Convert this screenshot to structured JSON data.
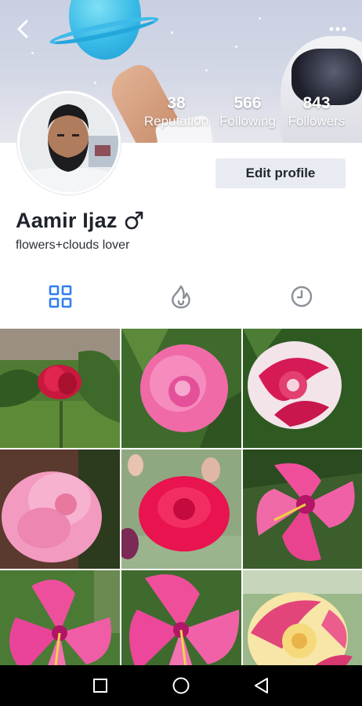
{
  "profile": {
    "name": "Aamir Ijaz",
    "gender_symbol": "male-symbol-icon",
    "bio": "flowers+clouds lover",
    "edit_label": "Edit profile"
  },
  "stats": [
    {
      "value": "38",
      "label": "Reputation"
    },
    {
      "value": "566",
      "label": "Following"
    },
    {
      "value": "843",
      "label": "Followers"
    }
  ],
  "tabs": [
    {
      "icon": "grid-icon",
      "active": true
    },
    {
      "icon": "flame-icon",
      "active": false
    },
    {
      "icon": "clock-icon",
      "active": false
    }
  ],
  "photos": [
    {
      "subject": "red-rose-garden-photo"
    },
    {
      "subject": "pink-rose-photo"
    },
    {
      "subject": "striped-red-white-rose-photo"
    },
    {
      "subject": "light-pink-rose-photo"
    },
    {
      "subject": "deep-pink-rose-photo"
    },
    {
      "subject": "pink-hibiscus-photo"
    },
    {
      "subject": "pink-hibiscus-photo"
    },
    {
      "subject": "pink-hibiscus-photo"
    },
    {
      "subject": "striped-pink-yellow-rose-photo"
    }
  ],
  "header": {
    "back_icon": "back-arrow-icon",
    "more_icon": "more-dots-icon"
  },
  "navbar": {
    "recents_icon": "square-icon",
    "home_icon": "circle-icon",
    "back_icon": "triangle-back-icon"
  },
  "colors": {
    "accent": "#2f7ff0",
    "inactive_icon": "#8a8f99",
    "edit_button_bg": "#e8ebf1",
    "text_primary": "#1f232b",
    "navbar_bg": "#000000"
  }
}
